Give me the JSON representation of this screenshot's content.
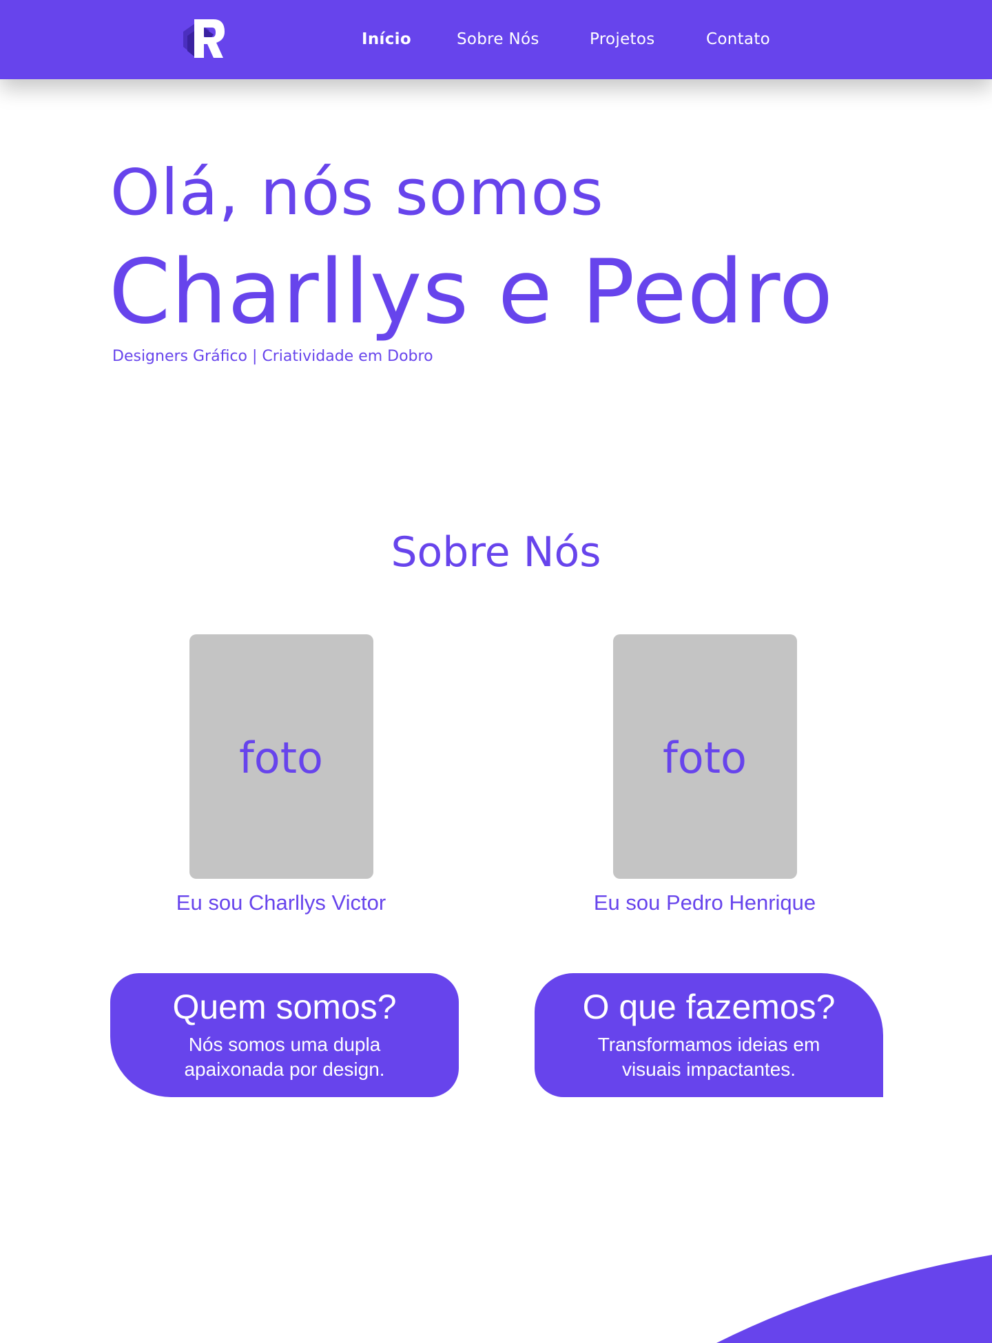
{
  "colors": {
    "accent": "#6744ec",
    "photo_placeholder": "#c4c4c4",
    "white": "#ffffff"
  },
  "nav": {
    "logo": "logo-icon",
    "links": [
      {
        "label": "Início",
        "active": true
      },
      {
        "label": "Sobre Nós",
        "active": false
      },
      {
        "label": "Projetos",
        "active": false
      },
      {
        "label": "Contato",
        "active": false
      }
    ]
  },
  "hero": {
    "greeting": "Olá, nós somos",
    "names": "Charllys e Pedro",
    "subtitle": "Designers Gráfico | Criatividade em Dobro"
  },
  "about": {
    "title": "Sobre Nós",
    "people": [
      {
        "photo_label": "foto",
        "name": "Eu sou Charllys Victor"
      },
      {
        "photo_label": "foto",
        "name": "Eu sou Pedro Henrique"
      }
    ],
    "cards": [
      {
        "title": "Quem somos?",
        "text": "Nós somos uma dupla apaixonada por design."
      },
      {
        "title": "O que fazemos?",
        "text": "Transformamos ideias em visuais impactantes."
      }
    ]
  },
  "decoration": {
    "wave": "wave-shape"
  }
}
